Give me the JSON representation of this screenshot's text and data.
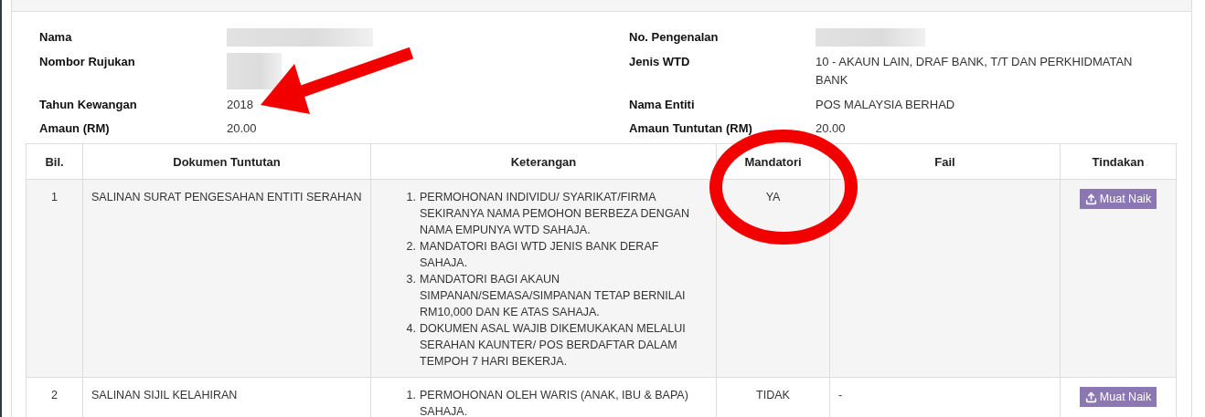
{
  "details": {
    "left": [
      {
        "label": "Nama",
        "redacted": true
      },
      {
        "label": "Nombor Rujukan",
        "redacted": true
      },
      {
        "label": "Tahun Kewangan",
        "value": "2018"
      },
      {
        "label": "Amaun (RM)",
        "value": "20.00"
      }
    ],
    "right": [
      {
        "label": "No. Pengenalan",
        "redacted": true
      },
      {
        "label": "Jenis WTD",
        "value": "10 - AKAUN LAIN, DRAF BANK, T/T DAN PERKHIDMATAN BANK"
      },
      {
        "label": "Nama Entiti",
        "value": "POS MALAYSIA BERHAD"
      },
      {
        "label": "Amaun Tuntutan (RM)",
        "value": "20.00"
      }
    ]
  },
  "table": {
    "columns": [
      "Bil.",
      "Dokumen Tuntutan",
      "Keterangan",
      "Mandatori",
      "Fail",
      "Tindakan"
    ],
    "rows": [
      {
        "no": "1",
        "document": "SALINAN SURAT PENGESAHAN ENTITI SERAHAN",
        "notes": [
          {
            "number": "1.",
            "text": "PERMOHONAN INDIVIDU/ SYARIKAT/FIRMA SEKIRANYA NAMA PEMOHON BERBEZA DENGAN NAMA EMPUNYA WTD SAHAJA."
          },
          {
            "number": "2.",
            "text": "MANDATORI BAGI WTD JENIS BANK DERAF SAHAJA."
          },
          {
            "number": "3.",
            "text": "MANDATORI BAGI AKAUN SIMPANAN/SEMASA/SIMPANAN TETAP BERNILAI RM10,000 DAN KE ATAS SAHAJA."
          },
          {
            "number": "4.",
            "text": "DOKUMEN ASAL WAJIB DIKEMUKAKAN MELALUI SERAHAN KAUNTER/ POS BERDAFTAR DALAM TEMPOH 7 HARI BEKERJA."
          }
        ],
        "mandatory": "YA",
        "action": "Muat Naik"
      },
      {
        "no": "2",
        "document": "SALINAN SIJIL KELAHIRAN",
        "notes": [
          {
            "number": "1.",
            "text": "PERMOHONAN OLEH WARIS (ANAK, IBU & BAPA) SAHAJA."
          }
        ],
        "mandatory": "TIDAK",
        "file": "-",
        "action": "Muat Naik"
      }
    ]
  },
  "annotations": [
    {
      "kind": "arrow"
    },
    {
      "kind": "circle"
    }
  ]
}
